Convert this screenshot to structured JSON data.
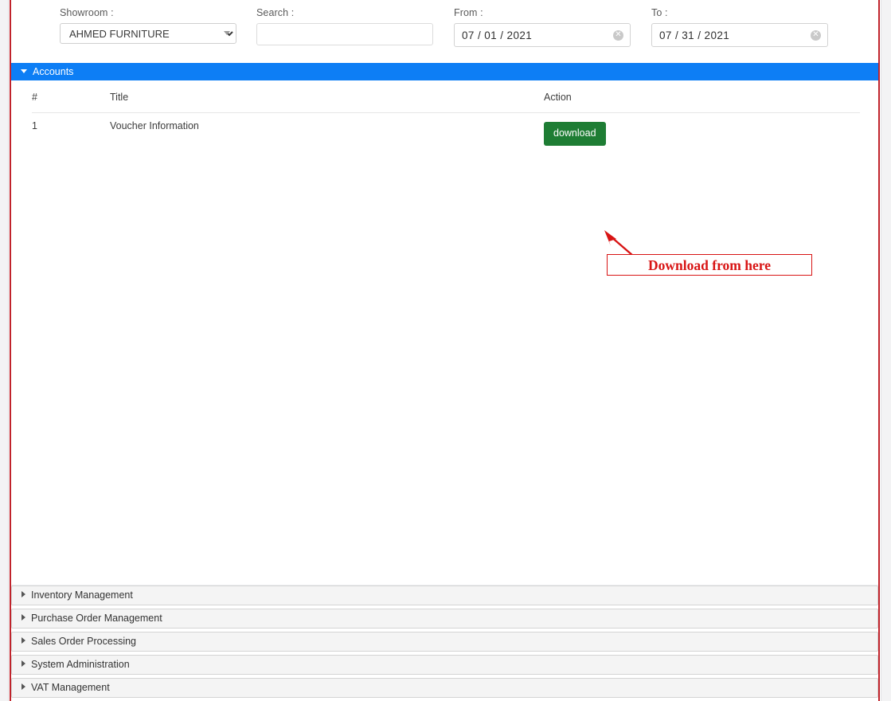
{
  "filters": {
    "showroom": {
      "label": "Showroom :",
      "value": "AHMED FURNITURE",
      "options": [
        "AHMED FURNITURE"
      ]
    },
    "search": {
      "label": "Search :",
      "value": "",
      "placeholder": ""
    },
    "from": {
      "label": "From :",
      "value": "07 / 01 / 2021",
      "clear_icon": "clear-circle-icon"
    },
    "to": {
      "label": "To :",
      "value": "07 / 31 / 2021",
      "clear_icon": "clear-circle-icon"
    }
  },
  "accounts_panel": {
    "title": "Accounts",
    "expanded": true,
    "toggle_icon": "caret-down-icon",
    "header_color": "#0d7ef5",
    "table": {
      "columns": [
        "#",
        "Title",
        "Action"
      ],
      "rows": [
        {
          "num": "1",
          "title": "Voucher Information",
          "action_label": "download"
        }
      ]
    }
  },
  "annotation": {
    "text": "Download from here",
    "color": "#d81414",
    "arrow_icon": "arrow-pointer-icon"
  },
  "modules": [
    {
      "label": "Inventory Management",
      "toggle_icon": "caret-right-icon"
    },
    {
      "label": "Purchase Order Management",
      "toggle_icon": "caret-right-icon"
    },
    {
      "label": "Sales Order Processing",
      "toggle_icon": "caret-right-icon"
    },
    {
      "label": "System Administration",
      "toggle_icon": "caret-right-icon"
    },
    {
      "label": "VAT Management",
      "toggle_icon": "caret-right-icon"
    }
  ]
}
